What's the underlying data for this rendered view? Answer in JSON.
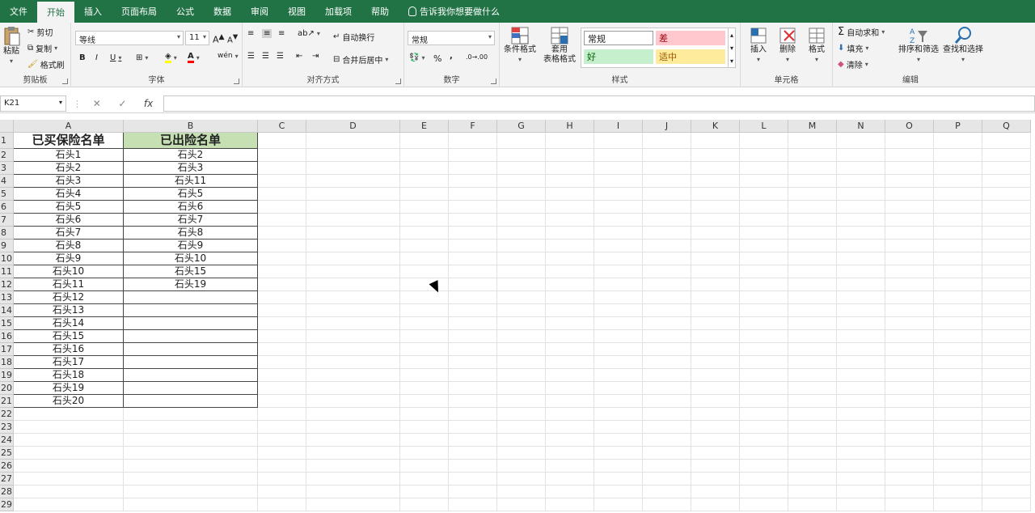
{
  "tabs": [
    "文件",
    "开始",
    "插入",
    "页面布局",
    "公式",
    "数据",
    "审阅",
    "视图",
    "加载项",
    "帮助"
  ],
  "active_tab": "开始",
  "tell_me": "告诉我你想要做什么",
  "clipboard": {
    "paste": "粘贴",
    "cut": "剪切",
    "copy": "复制",
    "format_painter": "格式刷",
    "label": "剪贴板"
  },
  "font": {
    "name": "等线",
    "size": "11",
    "bold": "B",
    "italic": "I",
    "underline": "U",
    "wen": "wén",
    "label": "字体"
  },
  "alignment": {
    "wrap": "自动换行",
    "merge": "合并后居中",
    "label": "对齐方式"
  },
  "number": {
    "format": "常规",
    "percent": "%",
    "comma": ",",
    "inc": ".0→.00",
    "dec": ".00→.0",
    "label": "数字"
  },
  "styles": {
    "conditional": "条件格式",
    "table": "套用\n表格格式",
    "normal": "常规",
    "bad": "差",
    "good": "好",
    "neutral": "适中",
    "label": "样式"
  },
  "cells": {
    "insert": "插入",
    "delete": "删除",
    "format": "格式",
    "label": "单元格"
  },
  "editing": {
    "autosum": "自动求和",
    "fill": "填充",
    "clear": "清除",
    "sort": "排序和筛选",
    "find": "查找和选择",
    "label": "编辑"
  },
  "formula_bar": {
    "name_box": "K21",
    "fx": "fx",
    "content": ""
  },
  "columns": [
    "A",
    "B",
    "C",
    "D",
    "E",
    "F",
    "G",
    "H",
    "I",
    "J",
    "K",
    "L",
    "M",
    "N",
    "O",
    "P",
    "Q"
  ],
  "rows": [
    "1",
    "2",
    "3",
    "4",
    "5",
    "6",
    "7",
    "8",
    "9",
    "10",
    "11",
    "12",
    "13",
    "14",
    "15",
    "16",
    "17",
    "18",
    "19",
    "20",
    "21",
    "22",
    "23",
    "24",
    "25",
    "26",
    "27",
    "28",
    "29"
  ],
  "sheet": {
    "colA_header": "已买保险名单",
    "colB_header": "已出险名单",
    "colA": [
      "石头1",
      "石头2",
      "石头3",
      "石头4",
      "石头5",
      "石头6",
      "石头7",
      "石头8",
      "石头9",
      "石头10",
      "石头11",
      "石头12",
      "石头13",
      "石头14",
      "石头15",
      "石头16",
      "石头17",
      "石头18",
      "石头19",
      "石头20"
    ],
    "colB": [
      "石头2",
      "石头3",
      "石头11",
      "石头5",
      "石头6",
      "石头7",
      "石头8",
      "石头9",
      "石头10",
      "石头15",
      "石头19"
    ]
  },
  "colors": {
    "brand": "#217346",
    "header_green": "#c6e0b4",
    "bad_bg": "#ffc7ce",
    "good_bg": "#c6efce",
    "neutral_bg": "#ffeb9c"
  }
}
